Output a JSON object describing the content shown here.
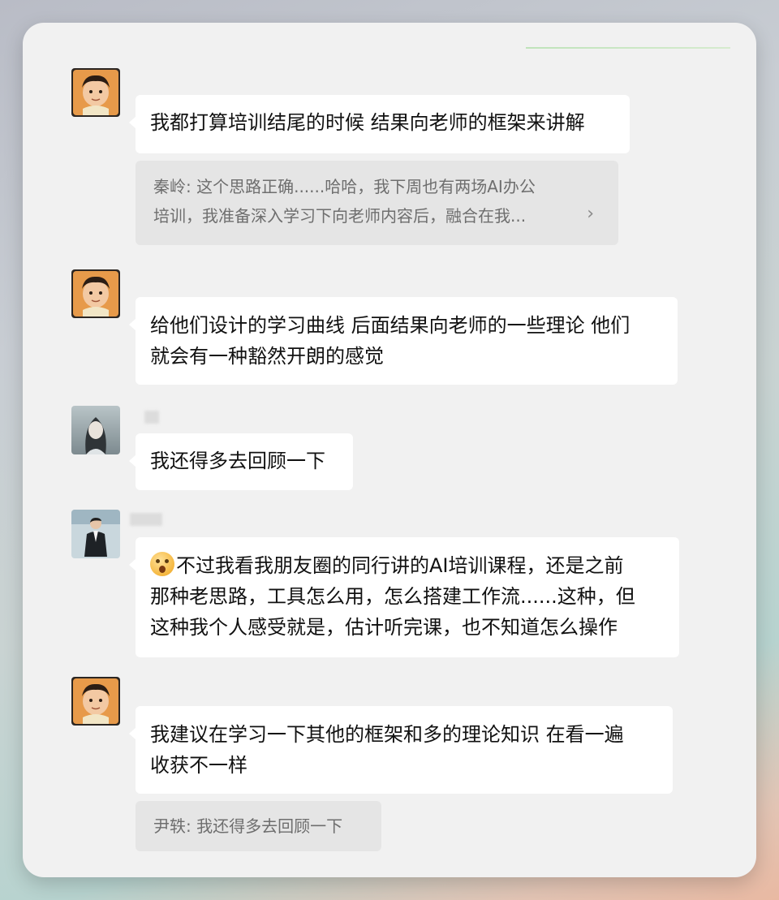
{
  "messages": [
    {
      "sender": "avatar-baby",
      "text": "我都打算培训结尾的时候 结果向老师的框架来讲解",
      "quote": {
        "line1": "秦岭: 这个思路正确......哈哈，我下周也有两场AI办公",
        "line2": "培训，我准备深入学习下向老师内容后，融合在我...",
        "chevron": "›"
      }
    },
    {
      "sender": "avatar-baby",
      "line1": "给他们设计的学习曲线 后面结果向老师的一些理论 他们",
      "line2": "就会有一种豁然开朗的感觉"
    },
    {
      "sender": "avatar-portrait",
      "text": "我还得多去回顾一下"
    },
    {
      "sender": "avatar-man-suit",
      "line1": "不过我看我朋友圈的同行讲的AI培训课程，还是之前",
      "line2": "那种老思路，工具怎么用，怎么搭建工作流......这种，但",
      "line3": "这种我个人感受就是，估计听完课，也不知道怎么操作"
    },
    {
      "sender": "avatar-baby",
      "line1": "我建议在学习一下其他的框架和多的理论知识 在看一遍",
      "line2": "收获不一样",
      "quote": {
        "text": "尹轶: 我还得多去回顾一下"
      }
    }
  ]
}
